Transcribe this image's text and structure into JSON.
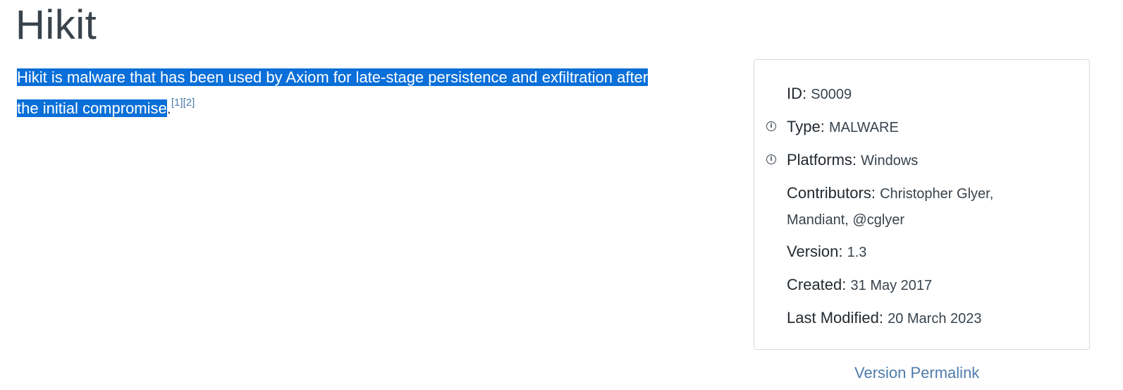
{
  "page": {
    "title": "Hikit",
    "description": {
      "text_selected": "Hikit is malware that has been used by Axiom for late-stage persistence and exfiltration after",
      "text_selected_line2": "the initial compromise",
      "text_after": ".",
      "refs": [
        "[1]",
        "[2]"
      ]
    }
  },
  "card": {
    "id": {
      "label": "ID:",
      "value": "S0009"
    },
    "type": {
      "label": "Type:",
      "value": "MALWARE",
      "icon": "info-icon"
    },
    "platforms": {
      "label": "Platforms:",
      "value": "Windows",
      "icon": "info-icon"
    },
    "contributors": {
      "label": "Contributors:",
      "value_line1": "Christopher Glyer,",
      "value_line2": "Mandiant, @cglyer"
    },
    "version": {
      "label": "Version:",
      "value": "1.3"
    },
    "created": {
      "label": "Created:",
      "value": "31 May 2017"
    },
    "last_modified": {
      "label": "Last Modified:",
      "value": "20 March 2023"
    }
  },
  "links": {
    "permalink": "Version Permalink"
  }
}
